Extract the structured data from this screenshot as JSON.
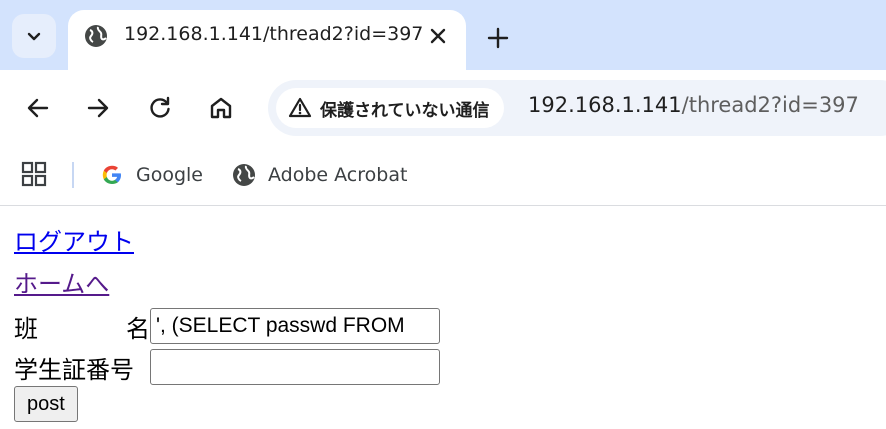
{
  "browser": {
    "tab": {
      "title": "192.168.1.141/thread2?id=397",
      "favicon": "globe-icon"
    },
    "omnibox": {
      "security_label": "保護されていない通信",
      "url_host": "192.168.1.141",
      "url_path": "/thread2?id=397"
    },
    "bookmarks": [
      {
        "label": "Google",
        "icon": "google-icon"
      },
      {
        "label": "Adobe Acrobat",
        "icon": "globe-icon"
      }
    ],
    "colors": {
      "tabstrip_bg": "#d3e3fd",
      "omnibox_bg": "#eff3fa"
    }
  },
  "page": {
    "links": {
      "logout": "ログアウト",
      "home": "ホームへ"
    },
    "form": {
      "group_label_left": "班",
      "group_label_right": "名",
      "group_value": "', (SELECT passwd FROM",
      "student_id_label": "学生証番号",
      "student_id_value": "",
      "submit_label": "post"
    },
    "colors": {
      "link": "#0000ee",
      "visited_link": "#551a8b"
    }
  }
}
